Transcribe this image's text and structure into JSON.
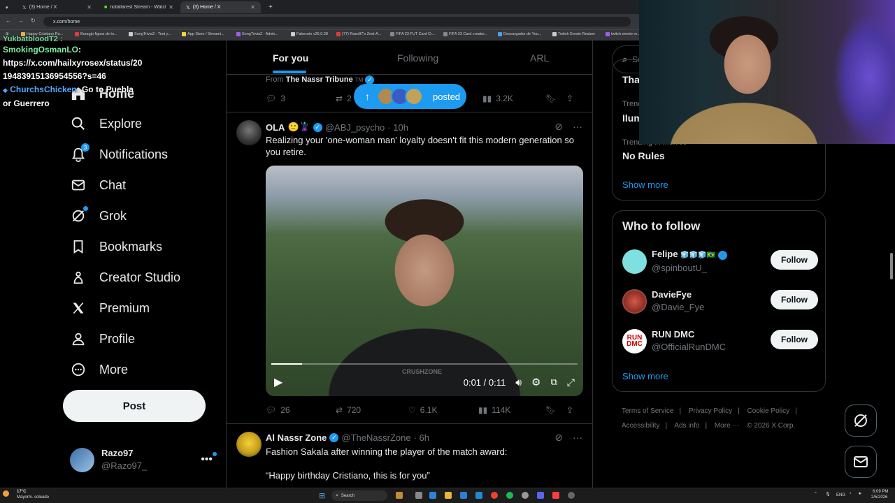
{
  "browser": {
    "tabs": [
      {
        "label": "(3) Home / X",
        "active": false
      },
      {
        "label": "notallarest Stream - Watch Liv",
        "active": false
      },
      {
        "label": "(3) Home / X",
        "active": true
      }
    ],
    "new_tab": "+",
    "url": "x.com/home",
    "bookmarks": [
      "Happy Cristiano Ro...",
      "Buragjo figura de to...",
      "SongTrivia2 - Test y...",
      "App Store / Streami...",
      "SongTrivia2 - Advin...",
      "Fakecoin v26.0.28",
      "(77) Razo97's Zest-A...",
      "FIFA 23 FUT Card Cr...",
      "FIFA 23 Card creator...",
      "Descargador de You...",
      "Twitch Emote Resizer",
      "twitch emote re..."
    ]
  },
  "chat_overlay": {
    "line0": "YukbatbloodT2 :",
    "user1": "SmokingOsmanLO",
    "line1b": ":",
    "line2": "https://x.com/hailxyrosex/status/20",
    "line3": "19483915136954556?s=46",
    "user2": "ChurchsChicken",
    "msg2": ": Go to Puebla",
    "msg2b": "or Guerrero"
  },
  "sidebar": {
    "items": [
      {
        "label": "Home",
        "icon": "home-icon"
      },
      {
        "label": "Explore",
        "icon": "search-icon"
      },
      {
        "label": "Notifications",
        "icon": "bell-icon",
        "badge": "3"
      },
      {
        "label": "Chat",
        "icon": "envelope-icon"
      },
      {
        "label": "Grok",
        "icon": "grok-icon"
      },
      {
        "label": "Bookmarks",
        "icon": "bookmark-icon"
      },
      {
        "label": "Creator Studio",
        "icon": "creator-icon"
      },
      {
        "label": "Premium",
        "icon": "x-logo-icon"
      },
      {
        "label": "Profile",
        "icon": "person-icon"
      },
      {
        "label": "More",
        "icon": "more-circle-icon"
      }
    ],
    "post_label": "Post",
    "profile": {
      "name": "Razo97",
      "handle": "@Razo97_"
    }
  },
  "feed": {
    "tabs": [
      "For you",
      "Following",
      "ARL"
    ],
    "prev_tweet": {
      "from_prefix": "From",
      "from_name": "The Nassr Tribune",
      "tm": "TM",
      "replies": "3",
      "retweets": "2",
      "views": "3.2K"
    },
    "posted_pill": {
      "label": "posted",
      "arrow": "↑"
    },
    "tweet1": {
      "name": "OLA",
      "emoji": "🙂🦹",
      "handle": "@ABJ_psycho",
      "time": "· 10h",
      "text": "Realizing your 'one-woman man' loyalty doesn't fit this modern generation so you retire.",
      "video": {
        "time": "0:01 / 0:11",
        "watermark": "CRUSHZONE",
        "progress": 0.1
      },
      "replies": "26",
      "retweets": "720",
      "likes": "6.1K",
      "views": "114K"
    },
    "tweet2": {
      "name": "Al Nassr Zone",
      "handle": "@TheNassrZone",
      "time": "· 6h",
      "text": "Fashion Sakala after winning the player of the match award:",
      "quote": "“Happy birthday Cristiano, this is for you”"
    }
  },
  "right": {
    "search_placeholder": "Se",
    "trends": {
      "partial_title": "Tha",
      "row1_cat": "Trend",
      "row1_title": "Ilum",
      "row2_cat": "Trending in Mexico",
      "row2_title": "No Rules",
      "show_more": "Show more"
    },
    "who_to_follow": {
      "title": "Who to follow",
      "users": [
        {
          "name": "Felipe",
          "suffix": "🧊🧊🧊🇧🇷",
          "handle": "@spinboutU_",
          "verified": true,
          "button": "Follow",
          "color": "#7fe0e0"
        },
        {
          "name": "DavieFye",
          "suffix": "",
          "handle": "@Davie_Fye",
          "verified": false,
          "button": "Follow",
          "color": "#b0453a"
        },
        {
          "name": "RUN DMC",
          "suffix": "",
          "handle": "@OfficialRunDMC",
          "verified": false,
          "button": "Follow",
          "color": "#ffffff"
        }
      ],
      "show_more": "Show more"
    },
    "footer": [
      "Terms of Service",
      "|",
      "Privacy Policy",
      "|",
      "Cookie Policy",
      "|",
      "Accessibility",
      "|",
      "Ads info",
      "|",
      "More ···",
      "© 2026 X Corp."
    ]
  },
  "taskbar": {
    "weather_temp": "17°C",
    "weather_desc": "Mayorm. soleado",
    "search": "Search",
    "lang": "ENG",
    "time": "6:09 PM",
    "date": "2/5/2026"
  },
  "colors": {
    "accent": "#1d9bf0",
    "background": "#000000",
    "text": "#e7e9ea",
    "muted": "#71767b"
  }
}
